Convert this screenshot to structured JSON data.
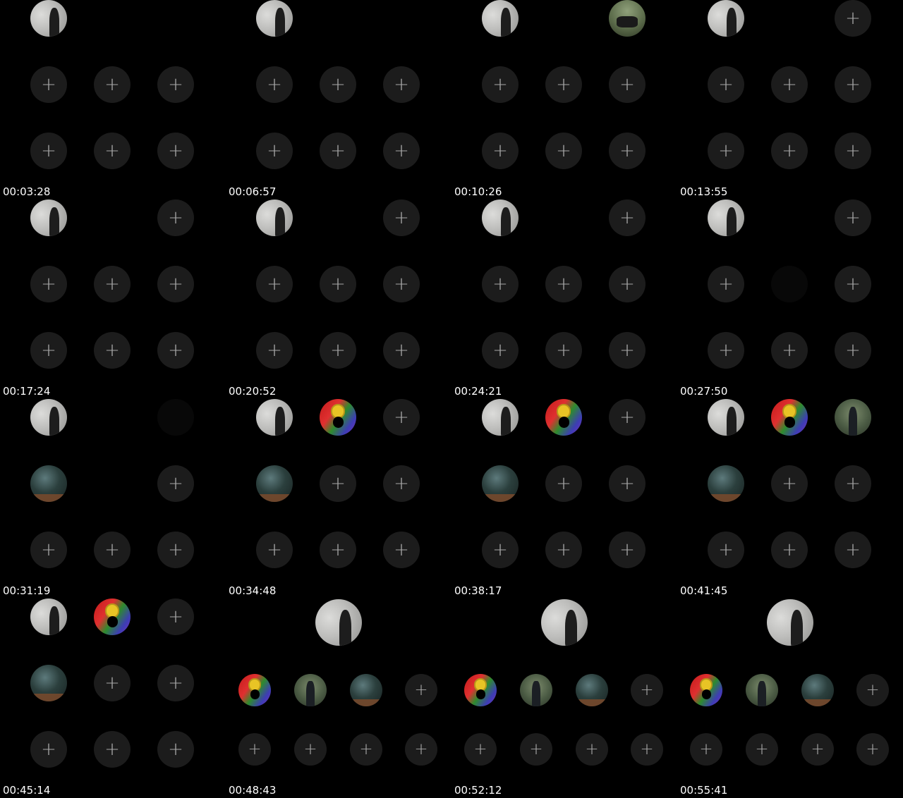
{
  "timestamps": [
    "00:03:28",
    "00:06:57",
    "00:10:26",
    "00:13:55",
    "00:17:24",
    "00:20:52",
    "00:24:21",
    "00:27:50",
    "00:31:19",
    "00:34:48",
    "00:38:17",
    "00:41:45",
    "00:45:14",
    "00:48:43",
    "00:52:12",
    "00:55:41"
  ],
  "add_glyph": "+",
  "frames": [
    {
      "layout": "grid3",
      "top": [
        "beach",
        "none",
        "none"
      ],
      "mid": [
        "add",
        "add",
        "add"
      ],
      "bot": [
        "add",
        "add",
        "add"
      ]
    },
    {
      "layout": "grid3",
      "top": [
        "beach",
        "none",
        "none"
      ],
      "mid": [
        "add",
        "add",
        "add"
      ],
      "bot": [
        "add",
        "add",
        "add"
      ]
    },
    {
      "layout": "grid3",
      "top": [
        "beach",
        "none",
        "bike"
      ],
      "mid": [
        "add",
        "add",
        "add"
      ],
      "bot": [
        "add",
        "add",
        "add"
      ]
    },
    {
      "layout": "grid3",
      "top": [
        "beach",
        "none",
        "add"
      ],
      "mid": [
        "add",
        "add",
        "add"
      ],
      "bot": [
        "add",
        "add",
        "add"
      ]
    },
    {
      "layout": "grid3",
      "top": [
        "beach",
        "none",
        "add"
      ],
      "mid": [
        "add",
        "add",
        "add"
      ],
      "bot": [
        "add",
        "add",
        "add"
      ]
    },
    {
      "layout": "grid3",
      "top": [
        "beach",
        "none",
        "add"
      ],
      "mid": [
        "add",
        "add",
        "add"
      ],
      "bot": [
        "add",
        "add",
        "add"
      ]
    },
    {
      "layout": "grid3",
      "top": [
        "beach",
        "none",
        "add"
      ],
      "mid": [
        "add",
        "add",
        "add"
      ],
      "bot": [
        "add",
        "add",
        "add"
      ]
    },
    {
      "layout": "grid3",
      "top": [
        "beach",
        "none",
        "add"
      ],
      "mid": [
        "add",
        "faint",
        "add"
      ],
      "bot": [
        "add",
        "add",
        "add"
      ]
    },
    {
      "layout": "grid3",
      "top": [
        "beach",
        "none",
        "faint"
      ],
      "mid": [
        "forest",
        "none",
        "add"
      ],
      "bot": [
        "add",
        "add",
        "add"
      ]
    },
    {
      "layout": "grid3",
      "top": [
        "beach",
        "flag",
        "add"
      ],
      "mid": [
        "forest",
        "add",
        "add"
      ],
      "bot": [
        "add",
        "add",
        "add"
      ]
    },
    {
      "layout": "grid3",
      "top": [
        "beach",
        "flag",
        "add"
      ],
      "mid": [
        "forest",
        "add",
        "add"
      ],
      "bot": [
        "add",
        "add",
        "add"
      ]
    },
    {
      "layout": "grid3",
      "top": [
        "beach",
        "flag",
        "man"
      ],
      "mid": [
        "forest",
        "add",
        "add"
      ],
      "bot": [
        "add",
        "add",
        "add"
      ]
    },
    {
      "layout": "grid3",
      "top": [
        "beach",
        "flag",
        "add"
      ],
      "mid": [
        "forest",
        "add",
        "add"
      ],
      "bot": [
        "add",
        "add",
        "add"
      ]
    },
    {
      "layout": "feature",
      "host": "beach",
      "row1": [
        "flag",
        "man",
        "forest",
        "add"
      ],
      "row2": [
        "add",
        "add",
        "add",
        "add"
      ]
    },
    {
      "layout": "feature",
      "host": "beach",
      "row1": [
        "flag",
        "man",
        "forest",
        "add"
      ],
      "row2": [
        "add",
        "add",
        "add",
        "add"
      ]
    },
    {
      "layout": "feature",
      "host": "beach",
      "row1": [
        "flag",
        "man",
        "forest",
        "add"
      ],
      "row2": [
        "add",
        "add",
        "add",
        "add"
      ]
    }
  ]
}
